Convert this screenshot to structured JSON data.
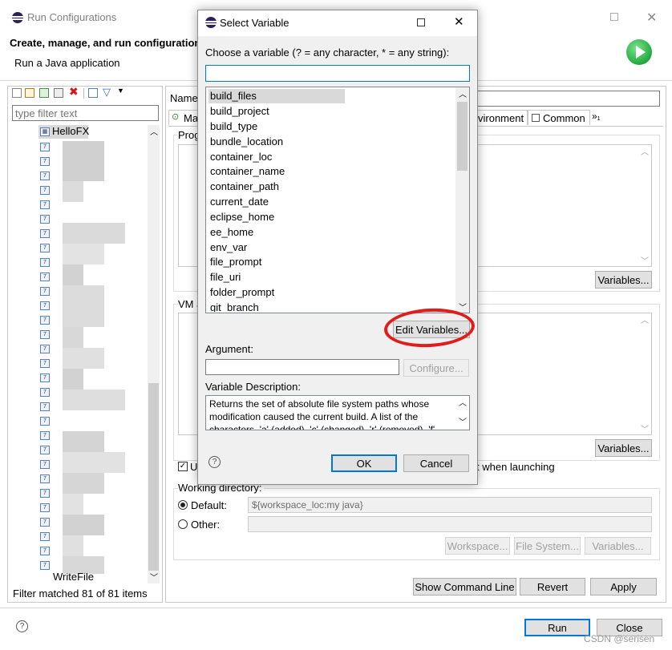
{
  "window": {
    "title": "Run Configurations",
    "heading": "Create, manage, and run configuration",
    "subheading": "Run a Java application"
  },
  "left": {
    "filter_placeholder": "type filter text",
    "tree_root": "HelloFX",
    "tree_last": "WriteFile",
    "filter_status": "Filter matched 81 of 81 items"
  },
  "right": {
    "name_label": "Name:",
    "tabs": [
      "Ma",
      "vironment",
      "Common",
      "»₁"
    ],
    "program_args_label": "Prog",
    "vm_args_label": "VM a",
    "variables_label": "Variables...",
    "use_label": "U",
    "launch_text": "t when launching",
    "working_dir_label": "Working directory:",
    "default_label": "Default:",
    "default_value": "${workspace_loc:my java}",
    "other_label": "Other:",
    "workspace_btn": "Workspace...",
    "filesystem_btn": "File System...",
    "variables_btn": "Variables..."
  },
  "bottom": {
    "show_cmd": "Show Command Line",
    "revert": "Revert",
    "apply": "Apply",
    "run": "Run",
    "close": "Close",
    "watermark": "CSDN @serisen"
  },
  "dialog": {
    "title": "Select Variable",
    "prompt": "Choose a variable (? = any character, * = any string):",
    "variables": [
      "build_files",
      "build_project",
      "build_type",
      "bundle_location",
      "container_loc",
      "container_name",
      "container_path",
      "current_date",
      "eclipse_home",
      "ee_home",
      "env_var",
      "file_prompt",
      "file_uri",
      "folder_prompt",
      "git_branch"
    ],
    "edit_variables": "Edit Variables...",
    "argument_label": "Argument:",
    "configure": "Configure...",
    "description_label": "Variable Description:",
    "description_line1": "Returns the set of absolute file system paths whose",
    "description_line2": "modification caused the current build. A list of the",
    "description_line3": "characters, 'a' (added), 'c' (changed), 'r' (removed), 'f'",
    "ok": "OK",
    "cancel": "Cancel"
  },
  "colors": {
    "selection": "#cce8ff",
    "highlight": "#e21b1b",
    "run_green": "#2db34a"
  }
}
